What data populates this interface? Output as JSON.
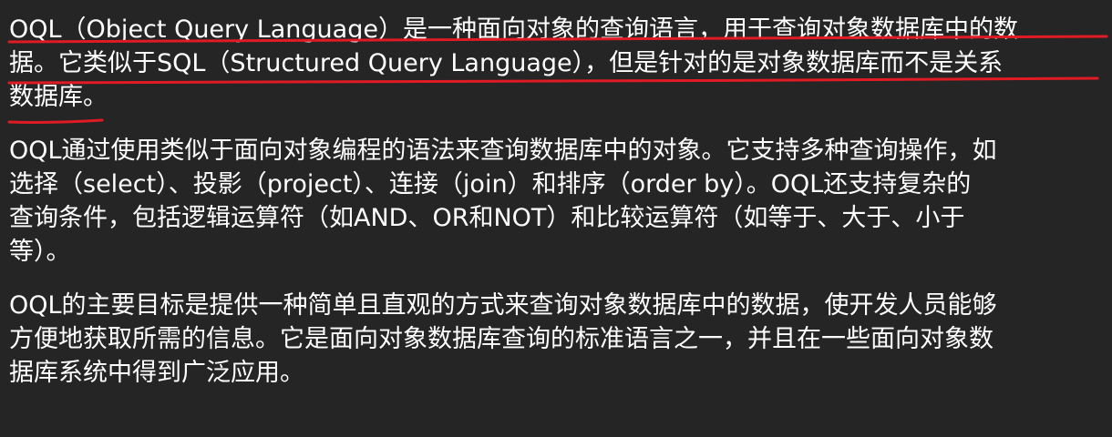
{
  "paragraphs": [
    {
      "lines": [
        "OQL（Object Query Language）是一种面向对象的查询语言，用于查询对象数据库中的数",
        "据。它类似于SQL（Structured Query Language），但是针对的是对象数据库而不是关系",
        "数据库。"
      ]
    },
    {
      "lines": [
        "OQL通过使用类似于面向对象编程的语法来查询数据库中的对象。它支持多种查询操作，如",
        "选择（select）、投影（project）、连接（join）和排序（order by）。OQL还支持复杂的",
        "查询条件，包括逻辑运算符（如AND、OR和NOT）和比较运算符（如等于、大于、小于",
        "等）。"
      ]
    },
    {
      "lines": [
        "OQL的主要目标是提供一种简单且直观的方式来查询对象数据库中的数据，使开发人员能够",
        "方便地获取所需的信息。它是面向对象数据库查询的标准语言之一，并且在一些面向对象数",
        "据库系统中得到广泛应用。"
      ]
    }
  ],
  "annotation_color": "#e01b24"
}
